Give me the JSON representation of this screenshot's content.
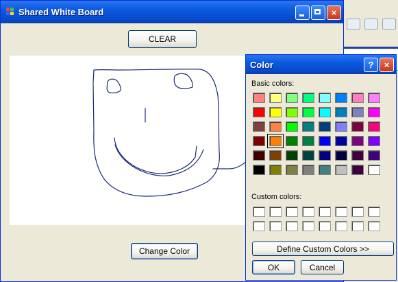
{
  "window": {
    "title": "Shared White Board"
  },
  "buttons": {
    "clear": "CLEAR",
    "change_color": "Change Color"
  },
  "color_dialog": {
    "title": "Color",
    "help_glyph": "?",
    "close_glyph": "×",
    "basic_label": "Basic colors:",
    "custom_label": "Custom colors:",
    "define_label": "Define Custom Colors >>",
    "ok_label": "OK",
    "cancel_label": "Cancel",
    "selected_index": 25,
    "basic_colors": [
      "#ff8080",
      "#ffff80",
      "#80ff80",
      "#00ff80",
      "#80ffff",
      "#0080ff",
      "#ff80c0",
      "#ff80ff",
      "#ff0000",
      "#ffff00",
      "#80ff00",
      "#00ff40",
      "#00ffff",
      "#0080c0",
      "#8080c0",
      "#ff00ff",
      "#804040",
      "#ff8040",
      "#00ff00",
      "#008080",
      "#004080",
      "#8080ff",
      "#800040",
      "#ff0080",
      "#800000",
      "#ff8000",
      "#008000",
      "#008040",
      "#0000ff",
      "#0000a0",
      "#800080",
      "#8000ff",
      "#400000",
      "#804000",
      "#004000",
      "#004040",
      "#000080",
      "#000040",
      "#400040",
      "#400080",
      "#000000",
      "#808000",
      "#808040",
      "#808080",
      "#408080",
      "#c0c0c0",
      "#400040",
      "#ffffff"
    ],
    "custom_colors": [
      "#ffffff",
      "#ffffff",
      "#ffffff",
      "#ffffff",
      "#ffffff",
      "#ffffff",
      "#ffffff",
      "#ffffff",
      "#ffffff",
      "#ffffff",
      "#ffffff",
      "#ffffff",
      "#ffffff",
      "#ffffff",
      "#ffffff",
      "#ffffff"
    ]
  },
  "stroke_color": "#1a2a7a"
}
